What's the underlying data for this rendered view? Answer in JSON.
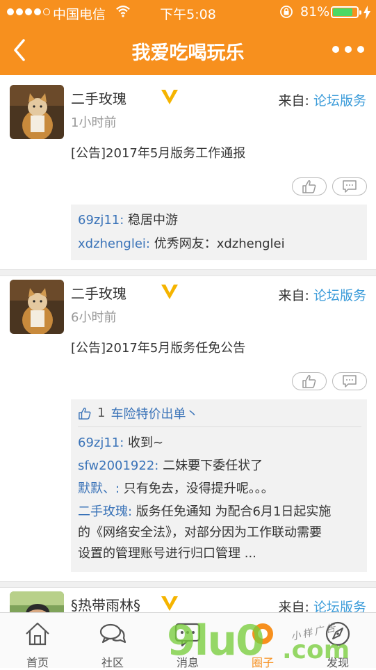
{
  "status_bar": {
    "carrier": "中国电信",
    "time": "下午5:08",
    "battery_pct": "81%",
    "battery_level": 0.81
  },
  "header": {
    "title": "我爱吃喝玩乐"
  },
  "posts": [
    {
      "author": "二手玫瑰",
      "time_ago": "1小时前",
      "source_prefix": "来自:",
      "source_link": "论坛版务",
      "title": "[公告]2017年5月版务工作通报",
      "comments": [
        {
          "user": "69zj11:",
          "text": " 稳居中游"
        },
        {
          "user": "xdzhenglei:",
          "text": " 优秀网友：xdzhenglei"
        }
      ]
    },
    {
      "author": "二手玫瑰",
      "time_ago": "6小时前",
      "source_prefix": "来自:",
      "source_link": "论坛版务",
      "title": "[公告]2017年5月版务任免公告",
      "like_count": "1",
      "like_users": "车险特价出单丶",
      "comments": [
        {
          "user": "69zj11:",
          "text": " 收到~"
        },
        {
          "user": "sfw2001922:",
          "text": " 二妹要下委任状了"
        },
        {
          "user": "默默、:",
          "text": " 只有免去，没得提升呢。。。"
        },
        {
          "user": "二手玫瑰:",
          "text": " 版务任免通知 为配合6月1日起实施",
          "line2": "的《网络安全法》，对部分因为工作联动需要",
          "line3": "设置的管理账号进行归口管理 ..."
        }
      ]
    },
    {
      "author": "§热带雨林§",
      "source_prefix": "来自:",
      "source_link": "论坛版务"
    }
  ],
  "tabbar": {
    "tabs": [
      {
        "label": "首页",
        "icon": "home-icon"
      },
      {
        "label": "社区",
        "icon": "community-icon"
      },
      {
        "label": "消息",
        "icon": "message-icon"
      },
      {
        "label": "圈子",
        "icon": "circle-icon"
      },
      {
        "label": "发现",
        "icon": "discover-icon"
      }
    ]
  },
  "watermark": {
    "main": "9lu0",
    "suffix": ".com",
    "handwriting": "小样广告"
  },
  "colors": {
    "accent": "#f7901e",
    "link": "#3a9bd9",
    "comment_user": "#3a73b8"
  }
}
